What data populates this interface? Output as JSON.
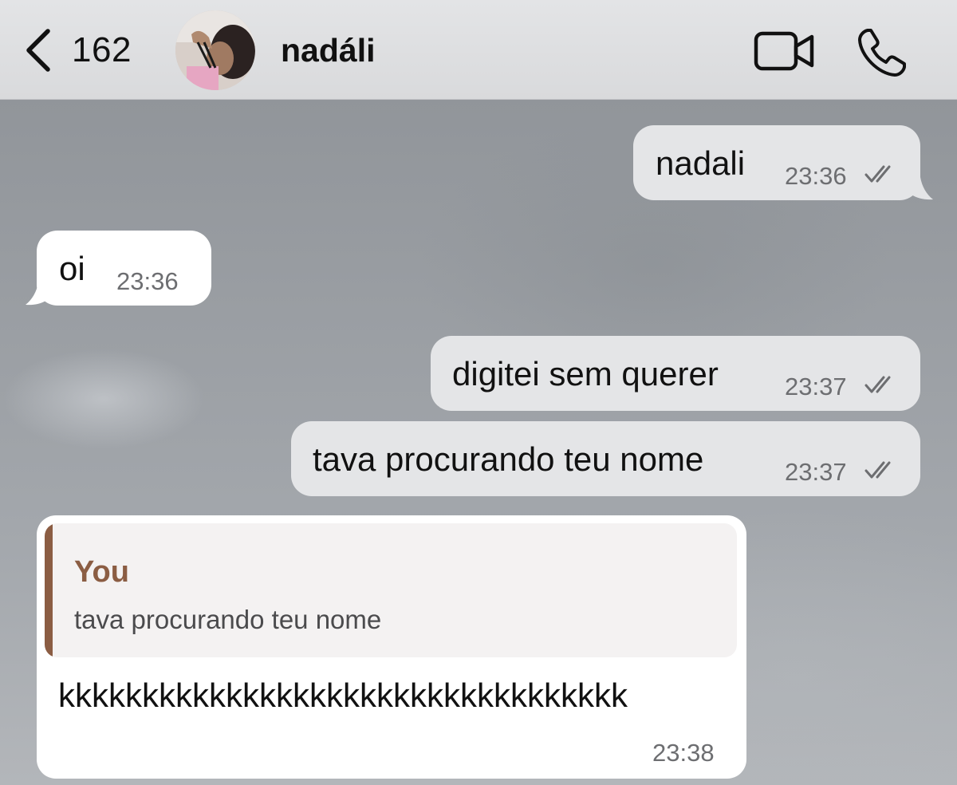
{
  "header": {
    "back_count": "162",
    "contact_name": "nadáli",
    "icons": {
      "back": "chevron-left-icon",
      "video": "video-camera-icon",
      "call": "phone-icon"
    }
  },
  "messages": [
    {
      "direction": "outgoing",
      "text": "nadali",
      "time": "23:36",
      "status": "read"
    },
    {
      "direction": "incoming",
      "text": "oi",
      "time": "23:36"
    },
    {
      "direction": "outgoing",
      "text": "digitei sem querer",
      "time": "23:37",
      "status": "read"
    },
    {
      "direction": "outgoing",
      "text": "tava procurando teu nome",
      "time": "23:37",
      "status": "read"
    },
    {
      "direction": "incoming",
      "quote": {
        "author": "You",
        "text": "tava procurando teu nome"
      },
      "text": "kkkkkkkkkkkkkkkkkkkkkkkkkkkkkkkkkk",
      "time": "23:38"
    }
  ],
  "colors": {
    "outgoing_bubble": "#e4e5e7",
    "incoming_bubble": "#ffffff",
    "quote_accent": "#8b5d43",
    "timestamp": "#6d6e71"
  }
}
